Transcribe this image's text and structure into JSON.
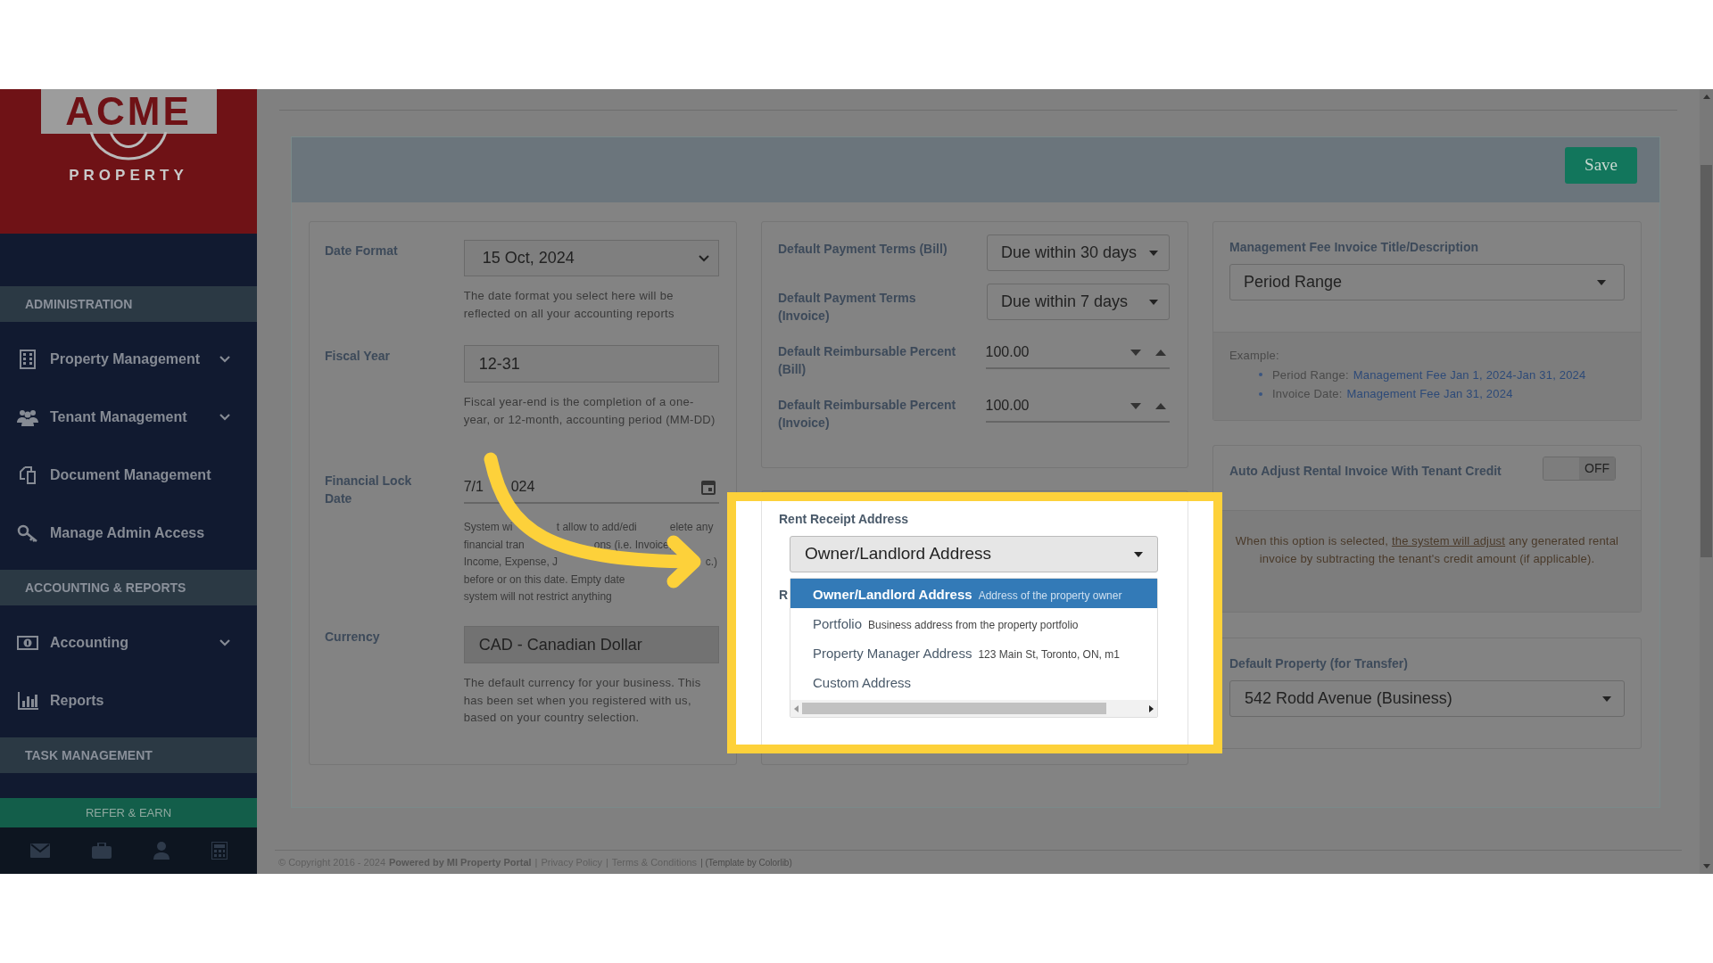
{
  "sidebar": {
    "logo": {
      "wordmark": "ACME",
      "tagline": "PROPERTY"
    },
    "sections": [
      {
        "title": "ADMINISTRATION",
        "items": [
          {
            "label": "Property Management",
            "has_submenu": true
          },
          {
            "label": "Tenant Management",
            "has_submenu": true
          },
          {
            "label": "Document Management",
            "has_submenu": false
          },
          {
            "label": "Manage Admin Access",
            "has_submenu": false
          }
        ]
      },
      {
        "title": "ACCOUNTING & REPORTS",
        "items": [
          {
            "label": "Accounting",
            "has_submenu": true
          },
          {
            "label": "Reports",
            "has_submenu": false
          }
        ]
      },
      {
        "title": "TASK MANAGEMENT"
      }
    ],
    "refer_button": "REFER & EARN"
  },
  "save_button": "Save",
  "general": {
    "fields": [
      {
        "kind": "select",
        "label": "Date Format",
        "value": "15 Oct, 2024",
        "help": "The date format you select here will be reflected on all your accounting reports"
      },
      {
        "kind": "text",
        "label": "Fiscal Year",
        "value": "12-31",
        "help": "Fiscal year-end is the completion of a one-year, or 12-month, accounting period (MM-DD)"
      },
      {
        "kind": "date",
        "label": "Financial Lock Date",
        "value_parts": [
          "7/1",
          "024"
        ],
        "help_lines": [
          [
            "System wi",
            "t allow to add/edi",
            "elete any"
          ],
          [
            "financial tran",
            "ons (i.e. Invoice,"
          ],
          [
            "Income, Expense, J",
            "c.)"
          ],
          [
            "before or on this date. Empty date"
          ],
          [
            "system will not restrict anything"
          ]
        ]
      },
      {
        "kind": "readonly",
        "label": "Currency",
        "value": "CAD - Canadian Dollar",
        "help": "The default currency for your business. This has been set when you registered with us, based on your country selection."
      }
    ]
  },
  "payment": {
    "fields": [
      {
        "kind": "select",
        "label": "Default Payment Terms (Bill)",
        "value": "Due within 30 days"
      },
      {
        "kind": "select",
        "label": "Default Payment Terms (Invoice)",
        "value": "Due within 7 days"
      },
      {
        "kind": "number",
        "label": "Default Reimbursable Percent (Bill)",
        "value": "100.00"
      },
      {
        "kind": "number",
        "label": "Default Reimbursable Percent (Invoice)",
        "value": "100.00"
      }
    ]
  },
  "rent_receipt": {
    "label": "Rent Receipt Address",
    "value": "Owner/Landlord Address",
    "next_label": "R",
    "options": [
      {
        "label": "Owner/Landlord Address",
        "detail": "Address of the property owner",
        "selected": true
      },
      {
        "label": "Portfolio",
        "detail": "Business address from the property portfolio",
        "selected": false
      },
      {
        "label": "Property Manager Address",
        "detail": "123 Main St, Toronto, ON, m1",
        "selected": false
      },
      {
        "label": "Custom Address",
        "selected": false
      }
    ]
  },
  "management_fee": {
    "label": "Management Fee Invoice Title/Description",
    "value": "Period Range",
    "example_title": "Example:",
    "examples": [
      {
        "name": "Period Range:",
        "value": "Management Fee Jan 1, 2024-Jan 31, 2024"
      },
      {
        "name": "Invoice Date:",
        "value": "Management Fee Jan 31, 2024"
      }
    ]
  },
  "auto_adjust": {
    "label": "Auto Adjust Rental Invoice With Tenant Credit",
    "on": false,
    "toggle_text": "OFF",
    "note_before": "When this option is selected,",
    "note_link": "the system will adjust",
    "note_after": "any generated rental invoice by subtracting the tenant's credit amount (if applicable)."
  },
  "default_property": {
    "label": "Default Property (for Transfer)",
    "value": "542 Rodd Avenue (Business)"
  },
  "footer": [
    {
      "kind": "plain",
      "text": "© Copyright 2016 - 2024"
    },
    {
      "kind": "bold",
      "text": "Powered by MI Property Portal"
    },
    {
      "kind": "sep",
      "text": "|"
    },
    {
      "kind": "link",
      "text": "Privacy Policy"
    },
    {
      "kind": "sep",
      "text": "|"
    },
    {
      "kind": "link",
      "text": "Terms & Conditions"
    },
    {
      "kind": "small",
      "text": "| (Template by Colorlib)"
    }
  ]
}
